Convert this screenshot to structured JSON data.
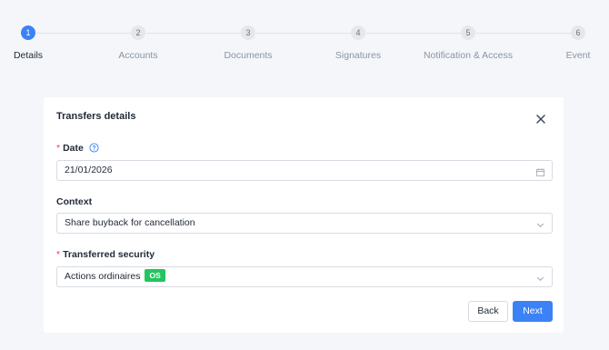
{
  "stepper": {
    "steps": [
      {
        "number": "1",
        "label": "Details"
      },
      {
        "number": "2",
        "label": "Accounts"
      },
      {
        "number": "3",
        "label": "Documents"
      },
      {
        "number": "4",
        "label": "Signatures"
      },
      {
        "number": "5",
        "label": "Notification & Access"
      },
      {
        "number": "6",
        "label": "Event"
      }
    ],
    "active_step": 1
  },
  "modal": {
    "title": "Transfers details",
    "close_icon": "close-icon",
    "fields": {
      "date": {
        "label": "Date",
        "required_mark": "*",
        "value": "21/01/2026",
        "icon": "calendar-icon",
        "help_icon": "help-circle-icon"
      },
      "context": {
        "label": "Context",
        "value": "Share buyback for cancellation",
        "icon": "chevron-down-icon"
      },
      "security": {
        "label": "Transferred security",
        "required_mark": "*",
        "value": "Actions ordinaires",
        "badge": "OS",
        "icon": "chevron-down-icon"
      }
    },
    "buttons": {
      "back": "Back",
      "next": "Next"
    }
  },
  "colors": {
    "accent": "#3b82f6",
    "badge": "#22c55e",
    "required": "#e5484d",
    "background": "#f4f6f9"
  }
}
